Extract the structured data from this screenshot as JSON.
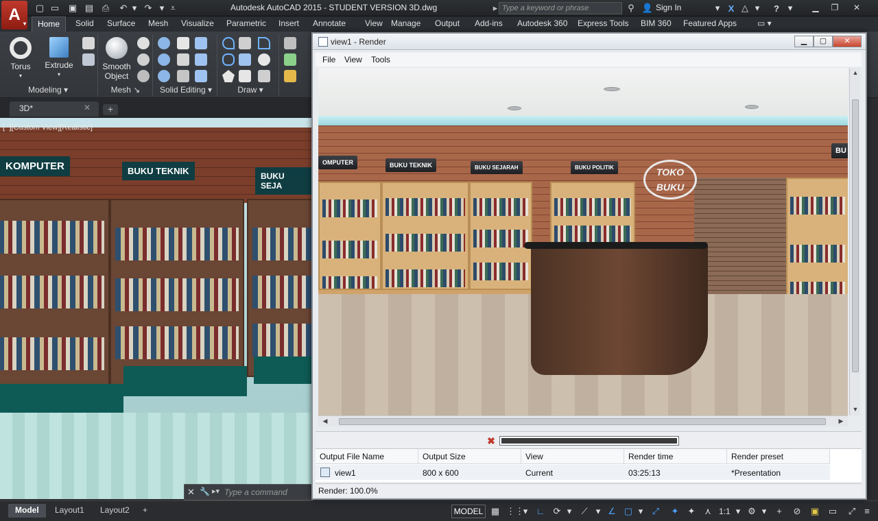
{
  "titlebar": {
    "title": "Autodesk AutoCAD 2015 - STUDENT VERSION    3D.dwg",
    "search_placeholder": "Type a keyword or phrase",
    "sign_in": "Sign In",
    "app_letter": "A"
  },
  "ribbon": {
    "tabs": [
      "Home",
      "Solid",
      "Surface",
      "Mesh",
      "Visualize",
      "Parametric",
      "Insert",
      "Annotate",
      "View",
      "Manage",
      "Output",
      "Add-ins",
      "Autodesk 360",
      "Express Tools",
      "BIM 360",
      "Featured Apps"
    ],
    "active_tab": "Home",
    "tools": {
      "torus": "Torus",
      "extrude": "Extrude",
      "smooth_object_line1": "Smooth",
      "smooth_object_line2": "Object"
    },
    "panels": {
      "modeling": "Modeling",
      "mesh": "Mesh",
      "solid_editing": "Solid Editing",
      "draw": "Draw"
    }
  },
  "filetabs": {
    "active": "3D*",
    "new_tab": "+"
  },
  "viewport": {
    "label": "[−][Custom View][Realistic]",
    "signs": [
      "KOMPUTER",
      "BUKU TEKNIK",
      "BUKU SEJA"
    ]
  },
  "command_line": {
    "prompt": "Type a command"
  },
  "statusbar": {
    "layout_tabs": [
      "Model",
      "Layout1",
      "Layout2"
    ],
    "active_layout": "Model",
    "model_button": "MODEL",
    "scale": "1:1"
  },
  "render_window": {
    "title": "view1 - Render",
    "menu": [
      "File",
      "View",
      "Tools"
    ],
    "scene_signs": [
      "OMPUTER",
      "BUKU TEKNIK",
      "BUKU SEJARAH",
      "BUKU POLITIK",
      "BU"
    ],
    "logo_line1": "TOKO",
    "logo_line2": "BUKU",
    "progress_fraction": 1.0,
    "history": {
      "columns": [
        "Output File Name",
        "Output Size",
        "View",
        "Render time",
        "Render preset"
      ],
      "rows": [
        [
          "view1",
          "800 x 600",
          "Current",
          "03:25:13",
          "*Presentation"
        ]
      ]
    },
    "status": "Render: 100.0%"
  },
  "colors": {
    "accent": "#1a73d6",
    "app_red": "#c0392b",
    "ribbon_bg": "#3b3f44"
  }
}
